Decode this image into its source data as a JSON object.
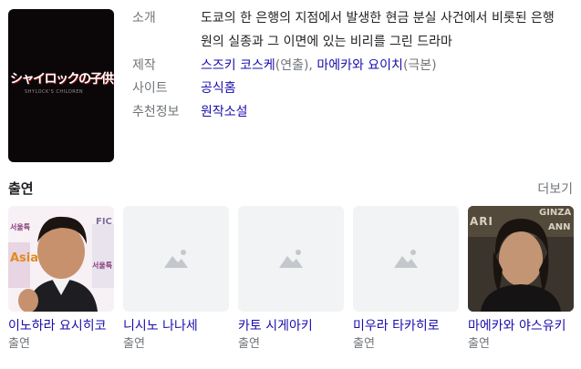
{
  "poster": {
    "title": "シャイロックの子供たち",
    "subtitle": "SHYLOCK'S CHILDREN"
  },
  "info": {
    "synopsis": {
      "label": "소개",
      "value": "도쿄의 한 은행의 지점에서 발생한 현금 분실 사건에서 비롯된 은행원의 실종과 그 이면에 있는 비리를 그린 드라마"
    },
    "production": {
      "label": "제작",
      "person1": "스즈키 코스케",
      "role1": "(연출), ",
      "person2": "마에카와 요이치",
      "role2": "(극본)"
    },
    "site": {
      "label": "사이트",
      "value": "공식홈"
    },
    "recommend": {
      "label": "추천정보",
      "value": "원작소설"
    }
  },
  "cast_section": {
    "title": "출연",
    "more": "더보기"
  },
  "cast": [
    {
      "name": "이노하라 요시히코",
      "role": "출연"
    },
    {
      "name": "니시노 나나세",
      "role": "출연"
    },
    {
      "name": "카토 시게아키",
      "role": "출연"
    },
    {
      "name": "미우라 타카히로",
      "role": "출연"
    },
    {
      "name": "마에카와 야스유키",
      "role": "출연"
    }
  ],
  "photo1_text": {
    "fic": "FIC",
    "seoul": "서울특",
    "asia": "Asia",
    "seoul2": "서울특"
  },
  "photo5_text": {
    "ginza": "GINZA",
    "ari": "ARI",
    "ann": "ANN"
  }
}
